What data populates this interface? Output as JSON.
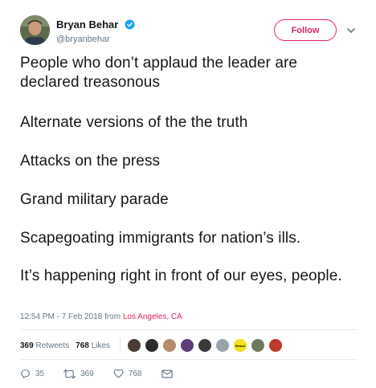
{
  "user": {
    "display_name": "Bryan Behar",
    "handle": "@bryanbehar",
    "verified_icon": "verified-badge-icon"
  },
  "follow_label": "Follow",
  "tweet": {
    "paragraphs": [
      "People who don’t applaud the leader are declared treasonous",
      "Alternate versions of the the truth",
      "Attacks on the press",
      "Grand military parade",
      "Scapegoating immigrants for nation’s ills.",
      "It’s happening right in front of our eyes, people."
    ],
    "timestamp": "12:54 PM - 7 Feb 2018 from ",
    "location": "Los Angeles, CA"
  },
  "stats": {
    "retweets_count": "369",
    "retweets_label": " Retweets",
    "likes_count": "768",
    "likes_label": " Likes",
    "liker_avatar_count": 10,
    "resist_badge": "Resist"
  },
  "actions": {
    "reply_count": "35",
    "retweet_count": "369",
    "like_count": "768"
  },
  "colors": {
    "brand_red": "#e0245e",
    "muted": "#657786",
    "verified_blue": "#1da1f2"
  }
}
